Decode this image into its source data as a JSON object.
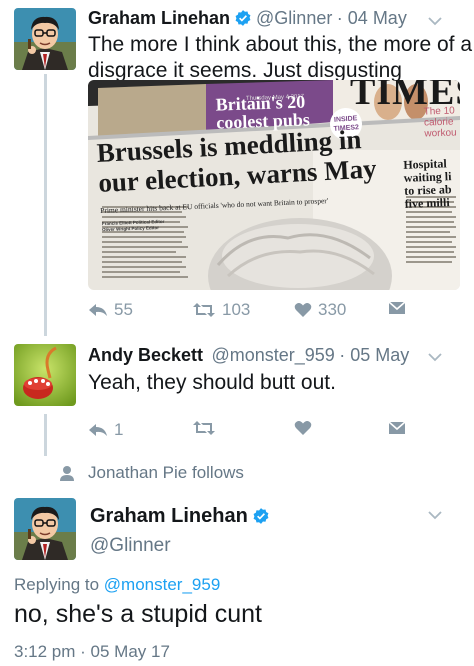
{
  "tweet1": {
    "name": "Graham Linehan",
    "handle": "@Glinner",
    "date": "· 04 May",
    "text_line1": "The more I think about this, the more of a",
    "text_line2": "disgrace it seems. Just disgusting",
    "replies": "55",
    "retweets": "103",
    "likes": "330",
    "newspaper": {
      "masthead": "TIMES",
      "dateline": "Thursday May 4 2017",
      "promo_title_1": "Britain's 20",
      "promo_title_2": "coolest pubs",
      "promo_badge_1": "INSIDE",
      "promo_badge_2": "TIMES2",
      "headline_1": "Brussels is meddling in",
      "headline_2": "our election, warns May",
      "standfirst": "Prime minister hits back at EU officials 'who do not want Britain to prosper'",
      "side_1": "The 10",
      "side_2": "calorie",
      "side_3": "workou",
      "side_head_1": "Hospital",
      "side_head_2": "waiting li",
      "side_head_3": "to rise ab",
      "side_head_4": "five milli",
      "byline_1": "Francis Elliott Political Editor",
      "byline_2": "Oliver Wright Policy Editor"
    }
  },
  "tweet2": {
    "name": "Andy Beckett",
    "handle": "@monster_959",
    "date": "· 05 May",
    "text": "Yeah, they should butt out.",
    "replies": "1"
  },
  "follows": {
    "text": "Jonathan Pie follows"
  },
  "tweet3": {
    "name": "Graham Linehan",
    "handle": "@Glinner",
    "replying_prefix": "Replying to",
    "replying_handle": "@monster_959",
    "text": "no, she's a stupid cunt",
    "timestamp": "3:12 pm · 05 May 17"
  },
  "colors": {
    "accent": "#1da1f2",
    "muted": "#8899a6",
    "text": "#14171a",
    "thread_line": "#ccd6dd"
  },
  "icons": [
    "reply-icon",
    "retweet-icon",
    "like-icon",
    "dm-icon",
    "chevron-down-icon",
    "verified-icon",
    "person-icon"
  ]
}
